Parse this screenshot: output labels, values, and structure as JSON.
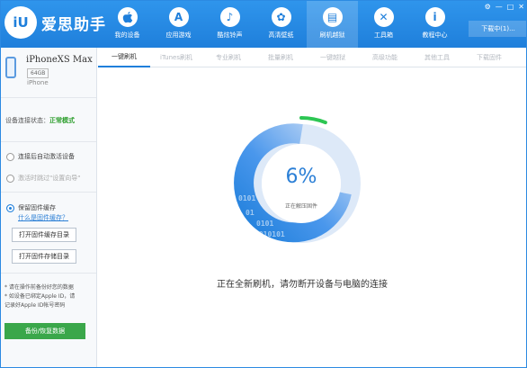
{
  "header": {
    "logo_text": "iU",
    "app_title": "爱思助手",
    "window_controls": [
      "⚙",
      "—",
      "□",
      "✕"
    ],
    "download_label": "下载中(1)..."
  },
  "nav": [
    {
      "label": "我的设备",
      "icon": "apple-icon",
      "glyph": ""
    },
    {
      "label": "应用游戏",
      "icon": "app-store-icon",
      "glyph": "A"
    },
    {
      "label": "酷炫铃声",
      "icon": "bell-icon",
      "glyph": "♪"
    },
    {
      "label": "高清壁纸",
      "icon": "flower-icon",
      "glyph": "✿"
    },
    {
      "label": "刷机越狱",
      "icon": "flash-box-icon",
      "glyph": "▤"
    },
    {
      "label": "工具箱",
      "icon": "tools-icon",
      "glyph": "✕"
    },
    {
      "label": "教程中心",
      "icon": "info-icon",
      "glyph": "i"
    }
  ],
  "sidebar": {
    "device_name": "iPhoneXS Max",
    "storage": "64GB",
    "device_type": "iPhone",
    "conn_label": "设备连接状态：",
    "conn_mode": "正常模式",
    "opt1": "连接后自动激活设备",
    "opt2": "激活时跳过\"设置向导\"",
    "opt3": "保留固件缓存",
    "cache_link": "什么是固件缓存？",
    "btn_open_cache": "打开固件缓存目录",
    "btn_open_storage": "打开固件存储目录",
    "note1": "* 请在操作前备份好您的数据",
    "note2": "* 如设备已绑定Apple ID，请",
    "note3": "记录好Apple ID帐号密码",
    "backup_btn": "备份/恢复数据"
  },
  "tabs": [
    "一键刷机",
    "iTunes刷机",
    "专业刷机",
    "批量刷机",
    "一键越狱",
    "高级功能",
    "其他工具",
    "下载固件"
  ],
  "progress": {
    "percent": 6,
    "percent_text": "6%",
    "status": "正在解压固件",
    "message": "正在全新刷机，请勿断开设备与电脑的连接",
    "binary": [
      "0101",
      "01",
      "0101",
      "01",
      "0101",
      "1010101",
      "01010101"
    ]
  },
  "colors": {
    "brand_blue": "#1f7fdb",
    "progress_green": "#2dc653",
    "ok_green": "#2a9d2a"
  }
}
